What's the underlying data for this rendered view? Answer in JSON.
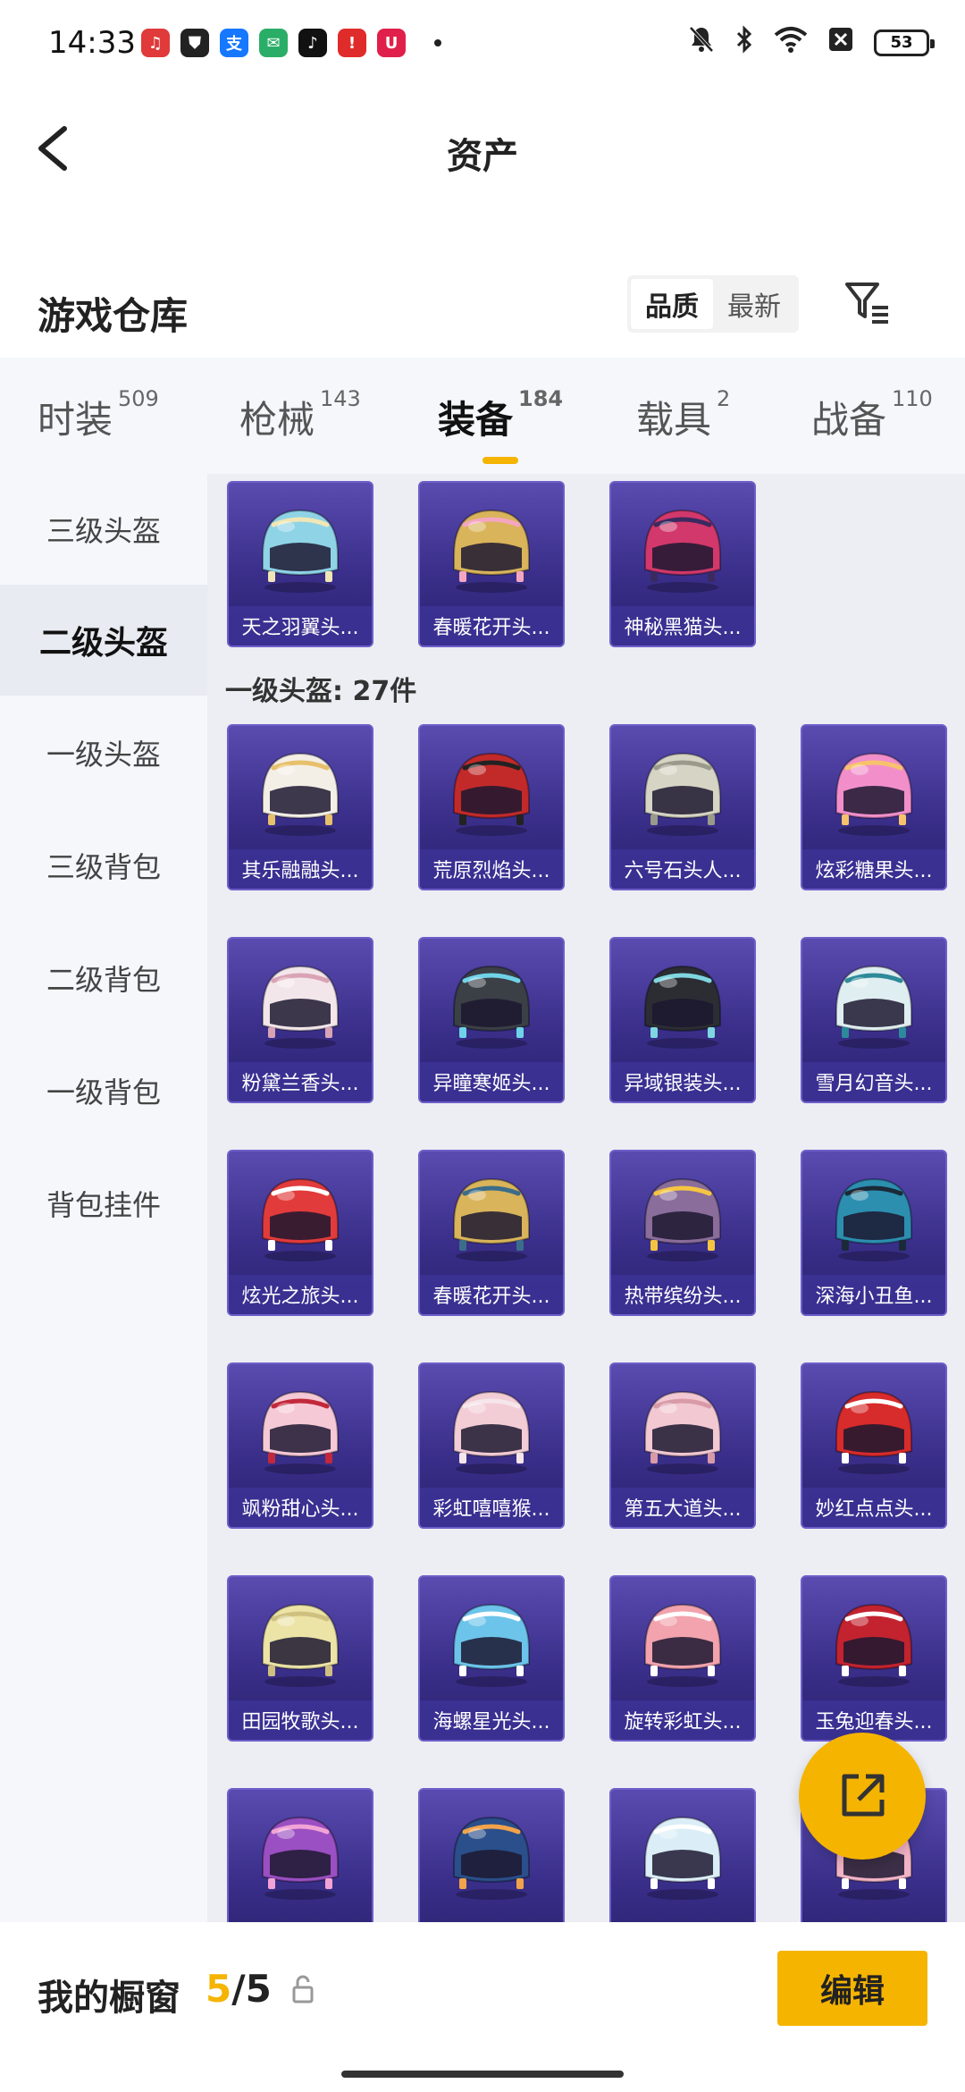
{
  "status_bar": {
    "time": "14:33",
    "apps": [
      {
        "name": "music-app-icon",
        "color": "#e03a3a",
        "glyph": "♫"
      },
      {
        "name": "shield-app-icon",
        "color": "#222222",
        "glyph": "⛊"
      },
      {
        "name": "alipay-app-icon",
        "color": "#1677ff",
        "glyph": "支"
      },
      {
        "name": "wechat-app-icon",
        "color": "#2aae67",
        "glyph": "✉"
      },
      {
        "name": "tiktok-app-icon",
        "color": "#111111",
        "glyph": "♪"
      },
      {
        "name": "red-app-icon",
        "color": "#e02b2b",
        "glyph": "!"
      },
      {
        "name": "shop-app-icon",
        "color": "#e0204a",
        "glyph": "U"
      }
    ],
    "battery": "53"
  },
  "nav": {
    "title": "资产"
  },
  "section": {
    "title": "游戏仓库",
    "sort_options": [
      "品质",
      "最新"
    ]
  },
  "tabs": [
    {
      "label": "时装",
      "count": "509"
    },
    {
      "label": "枪械",
      "count": "143"
    },
    {
      "label": "装备",
      "count": "184"
    },
    {
      "label": "载具",
      "count": "2"
    },
    {
      "label": "战备",
      "count": "110"
    }
  ],
  "sidebar": [
    {
      "label": "三级头盔"
    },
    {
      "label": "二级头盔"
    },
    {
      "label": "一级头盔"
    },
    {
      "label": "三级背包"
    },
    {
      "label": "二级背包"
    },
    {
      "label": "一级背包"
    },
    {
      "label": "背包挂件"
    }
  ],
  "group_title": "一级头盔: 27件",
  "items_level2": [
    {
      "label": "天之羽翼头...",
      "color": "#8fd3e6",
      "accent": "#f0e6b5"
    },
    {
      "label": "春暖花开头...",
      "color": "#d9b45a",
      "accent": "#f4a6c0"
    },
    {
      "label": "神秘黑猫头...",
      "color": "#d2386b",
      "accent": "#3b2a60"
    }
  ],
  "items_level1": [
    {
      "label": "其乐融融头...",
      "color": "#f4efe6",
      "accent": "#e6c06a"
    },
    {
      "label": "荒原烈焰头...",
      "color": "#c22a2a",
      "accent": "#222222"
    },
    {
      "label": "六号石头人...",
      "color": "#d6d4c4",
      "accent": "#9a9a8a"
    },
    {
      "label": "炫彩糖果头...",
      "color": "#f28fcb",
      "accent": "#f7c26b"
    },
    {
      "label": "粉黛兰香头...",
      "color": "#f3e6ea",
      "accent": "#d9a3b5"
    },
    {
      "label": "异瞳寒姬头...",
      "color": "#3b3f46",
      "accent": "#6fd3e8"
    },
    {
      "label": "异域银装头...",
      "color": "#2b2d33",
      "accent": "#7fd6e0"
    },
    {
      "label": "雪月幻音头...",
      "color": "#dfeef0",
      "accent": "#2d8a9a"
    },
    {
      "label": "炫光之旅头...",
      "color": "#e23b3b",
      "accent": "#ffffff"
    },
    {
      "label": "春暖花开头...",
      "color": "#d9b45a",
      "accent": "#3b6d8a"
    },
    {
      "label": "热带缤纷头...",
      "color": "#8a6d9a",
      "accent": "#f5c542"
    },
    {
      "label": "深海小丑鱼...",
      "color": "#2c8fb0",
      "accent": "#1b2a38"
    },
    {
      "label": "飒粉甜心头...",
      "color": "#f6c9d6",
      "accent": "#c2283b"
    },
    {
      "label": "彩虹嘻嘻猴...",
      "color": "#f3cdd6",
      "accent": "#f6e5ea"
    },
    {
      "label": "第五大道头...",
      "color": "#f2c8d2",
      "accent": "#d99aa8"
    },
    {
      "label": "妙红点点头...",
      "color": "#d82b2b",
      "accent": "#ffffff"
    },
    {
      "label": "田园牧歌头...",
      "color": "#ece3a6",
      "accent": "#cfc080"
    },
    {
      "label": "海螺星光头...",
      "color": "#6cc4ea",
      "accent": "#ffffff"
    },
    {
      "label": "旋转彩虹头...",
      "color": "#f2a3ad",
      "accent": "#ffffff"
    },
    {
      "label": "玉兔迎春头...",
      "color": "#c2232f",
      "accent": "#ffffff"
    },
    {
      "label": "",
      "color": "#9a4fc2",
      "accent": "#f2a3d6"
    },
    {
      "label": "",
      "color": "#2a4f8a",
      "accent": "#f2a34a"
    },
    {
      "label": "",
      "color": "#dbeef7",
      "accent": "#ffffff"
    },
    {
      "label": "",
      "color": "#f2b3c6",
      "accent": "#ffffff"
    }
  ],
  "bottom": {
    "label": "我的橱窗",
    "current": "5",
    "total": "/5",
    "edit_label": "编辑"
  }
}
